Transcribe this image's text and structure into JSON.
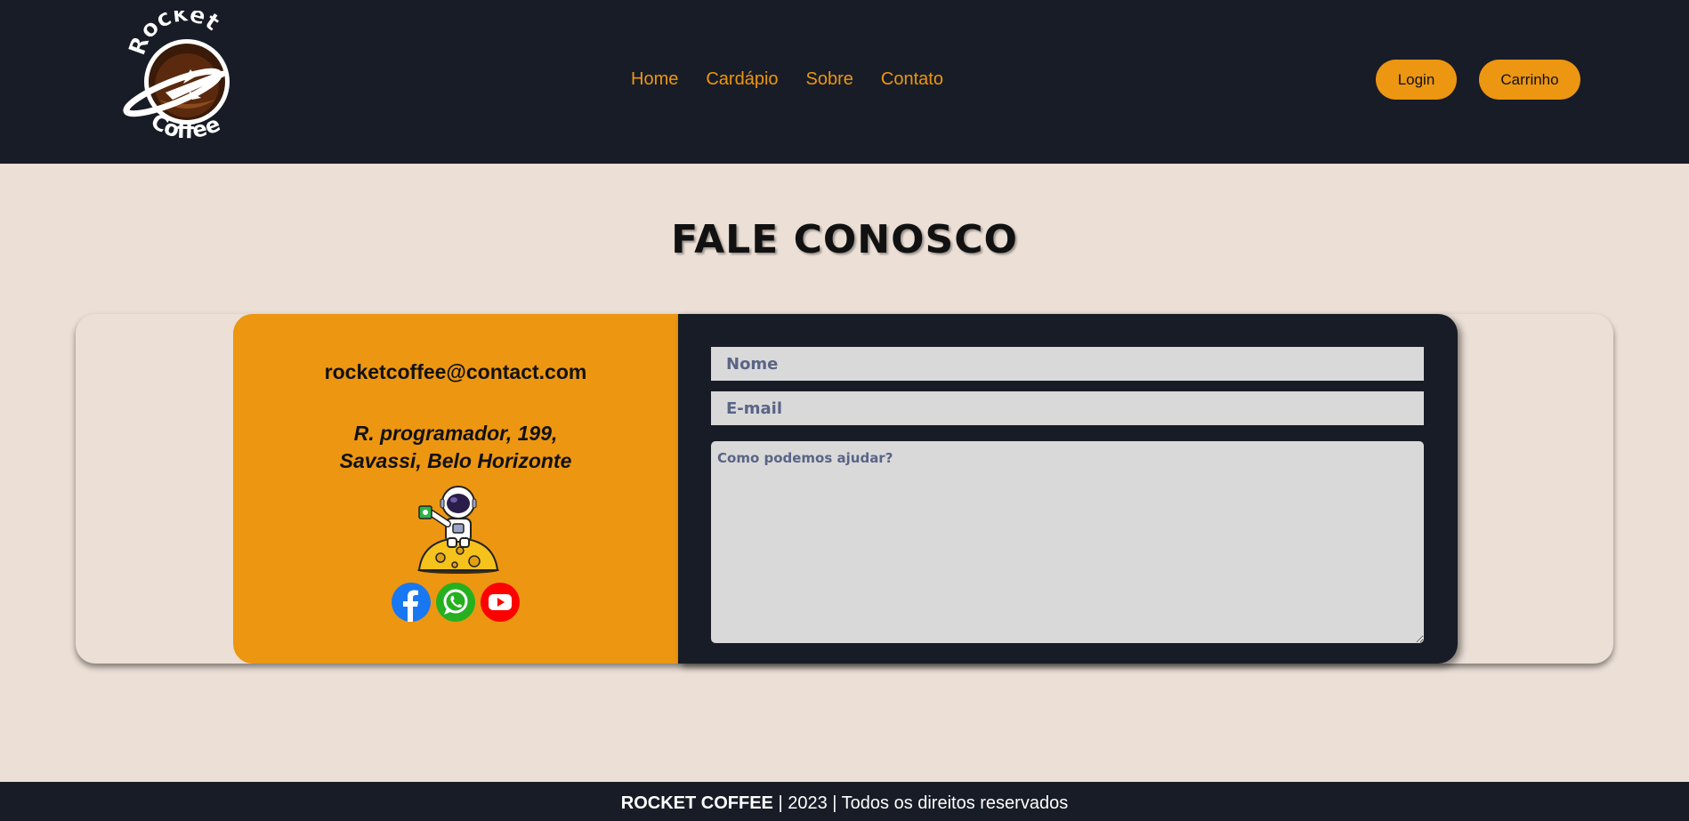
{
  "header": {
    "logo": {
      "top_text": "Rocket",
      "bottom_text": "Coffee"
    },
    "nav": [
      {
        "label": "Home"
      },
      {
        "label": "Cardápio"
      },
      {
        "label": "Sobre"
      },
      {
        "label": "Contato"
      }
    ],
    "login_label": "Login",
    "cart_label": "Carrinho"
  },
  "page_title": "FALE CONOSCO",
  "contact": {
    "email": "rocketcoffee@contact.com",
    "address_line1": "R. programador, 199,",
    "address_line2": "Savassi, Belo Horizonte",
    "socials": [
      "facebook-icon",
      "whatsapp-icon",
      "youtube-icon"
    ]
  },
  "form": {
    "name_placeholder": "Nome",
    "email_placeholder": "E-mail",
    "message_placeholder": "Como podemos ajudar?"
  },
  "footer": {
    "brand": "ROCKET COFFEE",
    "rest": " | 2023 | Todos os direitos reservados"
  },
  "colors": {
    "dark": "#181c26",
    "accent": "#ec9612",
    "background": "#ebdfd6",
    "field": "#d9d9d9"
  }
}
